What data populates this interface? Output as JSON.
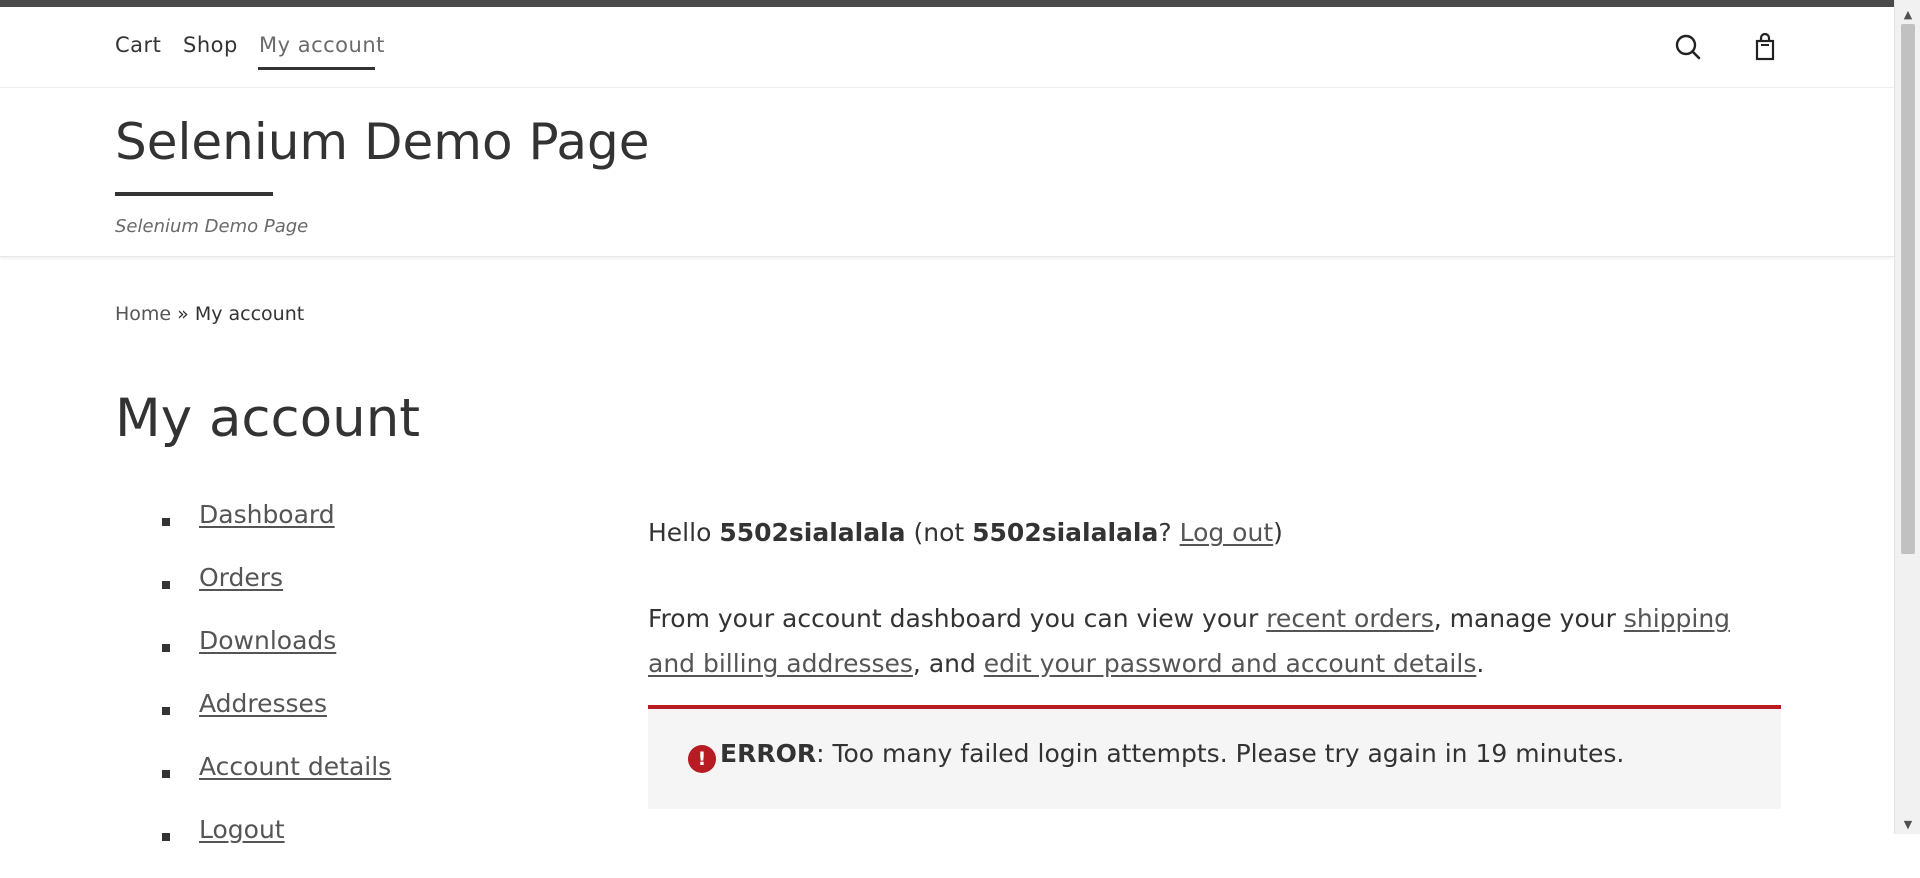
{
  "nav": {
    "items": [
      {
        "label": "Cart"
      },
      {
        "label": "Shop"
      },
      {
        "label": "My account"
      }
    ],
    "search_icon": "search-icon",
    "cart_icon": "shopping-bag-icon"
  },
  "header": {
    "site_title": "Selenium Demo Page",
    "tagline": "Selenium Demo Page"
  },
  "breadcrumb": {
    "home": "Home",
    "separator": " » ",
    "current": "My account"
  },
  "page_title": "My account",
  "account_menu": [
    {
      "label": "Dashboard"
    },
    {
      "label": "Orders"
    },
    {
      "label": "Downloads"
    },
    {
      "label": "Addresses"
    },
    {
      "label": "Account details"
    },
    {
      "label": "Logout"
    }
  ],
  "dashboard": {
    "hello": "Hello ",
    "username": "5502sialalala",
    "not_prefix": " (not ",
    "username_again": "5502sialalala",
    "question": "? ",
    "logout_link": "Log out",
    "close_paren": ")",
    "intro_1": "From your account dashboard you can view your ",
    "recent_orders_link": "recent orders",
    "intro_2": ", manage your ",
    "addresses_link": "shipping and billing addresses",
    "intro_3": ", and ",
    "account_link": "edit your password and account details",
    "intro_4": "."
  },
  "error": {
    "icon": "!",
    "label": "ERROR",
    "message": ": Too many failed login attempts. Please try again in 19 minutes."
  },
  "colors": {
    "error_accent": "#b81c23",
    "text": "#333333"
  }
}
